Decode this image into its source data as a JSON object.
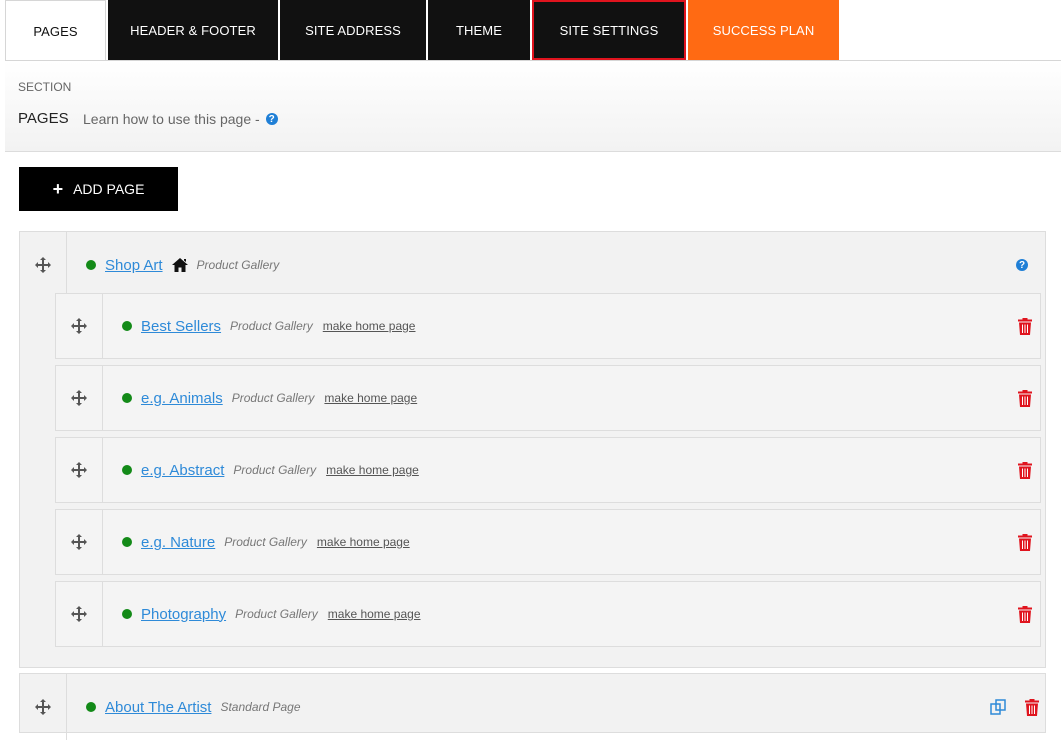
{
  "tabs": [
    {
      "label": "PAGES",
      "state": "active"
    },
    {
      "label": "HEADER & FOOTER",
      "state": "normal"
    },
    {
      "label": "SITE ADDRESS",
      "state": "normal"
    },
    {
      "label": "THEME",
      "state": "normal"
    },
    {
      "label": "SITE SETTINGS",
      "state": "highlighted"
    },
    {
      "label": "SUCCESS PLAN",
      "state": "accent"
    }
  ],
  "section": {
    "label": "SECTION",
    "title": "PAGES",
    "learn_text": "Learn how to use this page -",
    "help_icon": "question-circle-icon"
  },
  "add_page": {
    "label": "ADD PAGE",
    "icon": "plus-icon"
  },
  "pages": [
    {
      "title": "Shop Art",
      "type": "Product Gallery",
      "is_home": true,
      "status": "published",
      "children": [
        {
          "title": "Best Sellers",
          "type": "Product Gallery",
          "action": "make home page"
        },
        {
          "title": "e.g. Animals",
          "type": "Product Gallery",
          "action": "make home page"
        },
        {
          "title": "e.g. Abstract",
          "type": "Product Gallery",
          "action": "make home page"
        },
        {
          "title": "e.g. Nature",
          "type": "Product Gallery",
          "action": "make home page"
        },
        {
          "title": "Photography",
          "type": "Product Gallery",
          "action": "make home page"
        }
      ]
    },
    {
      "title": "About The Artist",
      "type": "Standard Page",
      "status": "published"
    }
  ],
  "colors": {
    "accent_orange": "#ff6a13",
    "tab_dark": "#111111",
    "link_blue": "#2e8ad8",
    "status_green": "#138a18",
    "delete_red": "#e0141e",
    "highlight_border": "#e0141e"
  }
}
